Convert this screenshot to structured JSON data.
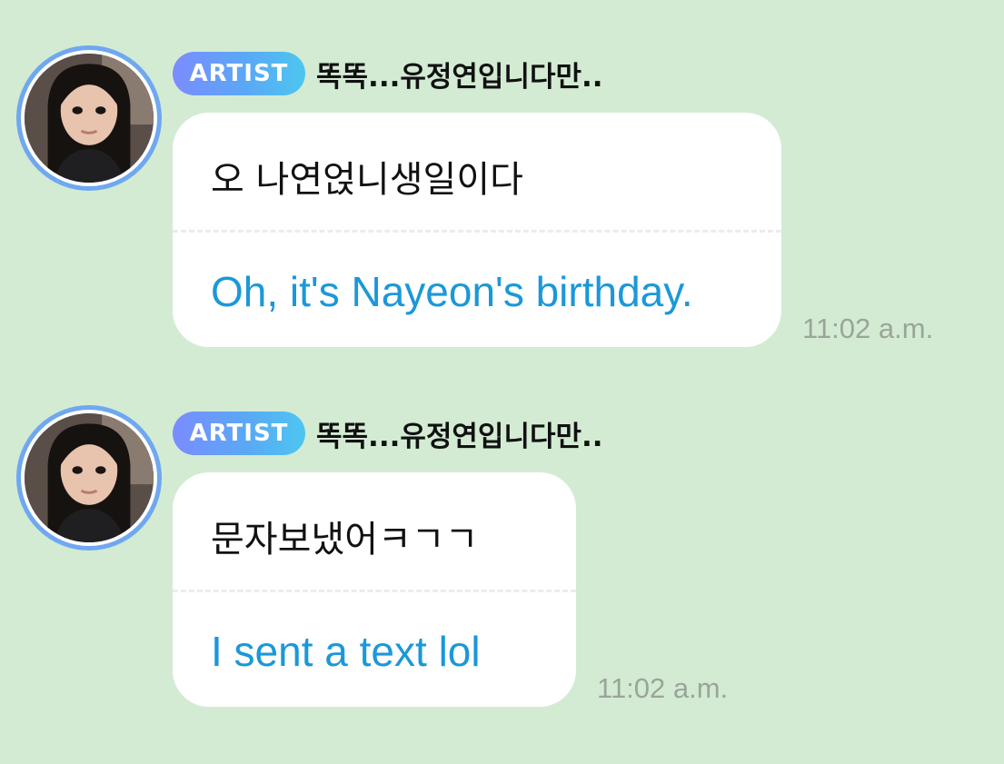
{
  "messages": [
    {
      "badge": "ARTIST",
      "sender": "똑똑...유정연입니다만..",
      "original": "오 나연얹니생일이다",
      "translation": "Oh, it's Nayeon's birthday.",
      "time": "11:02 a.m."
    },
    {
      "badge": "ARTIST",
      "sender": "똑똑...유정연입니다만..",
      "original": "문자보냈어ㅋㄱㄱ",
      "translation": "I sent a text lol",
      "time": "11:02 a.m."
    }
  ],
  "colors": {
    "background": "#d3ebd3",
    "bubble": "#ffffff",
    "translation_text": "#1b98d8",
    "timestamp": "#9aa59a",
    "avatar_ring": "#6fa8f0",
    "badge_gradient_start": "#7b8cff",
    "badge_gradient_end": "#4dc6f0"
  },
  "icons": {
    "avatar": "profile-photo"
  }
}
